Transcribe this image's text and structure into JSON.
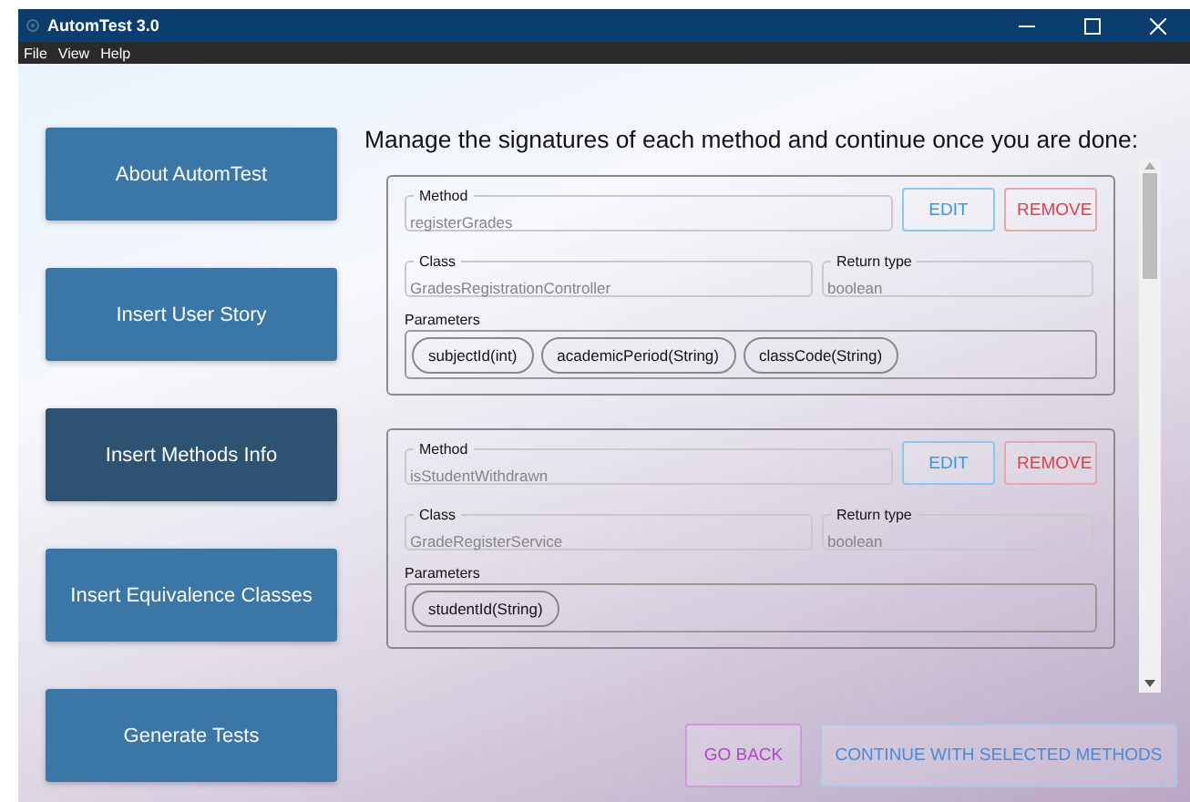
{
  "window": {
    "title": "AutomTest 3.0"
  },
  "menu": [
    "File",
    "View",
    "Help"
  ],
  "sidebar": {
    "items": [
      {
        "label": "About AutomTest",
        "selected": false
      },
      {
        "label": "Insert User Story",
        "selected": false
      },
      {
        "label": "Insert Methods Info",
        "selected": true
      },
      {
        "label": "Insert Equivalence Classes",
        "selected": false
      },
      {
        "label": "Generate Tests",
        "selected": false
      }
    ]
  },
  "heading": "Manage the signatures of each method and continue once you are done:",
  "methods": [
    {
      "method_label": "Method",
      "method": "registerGrades",
      "disabled": true,
      "edit": "EDIT",
      "remove": "REMOVE",
      "class_label": "Class",
      "class": "GradesRegistrationController",
      "return_label": "Return type",
      "return_type": "boolean",
      "parameters_label": "Parameters",
      "parameters": [
        "subjectId(int)",
        "academicPeriod(String)",
        "classCode(String)"
      ]
    },
    {
      "method_label": "Method",
      "method": "isStudentWithdrawn",
      "disabled": true,
      "edit": "EDIT",
      "remove": "REMOVE",
      "class_label": "Class",
      "class": "GradeRegisterService",
      "return_label": "Return type",
      "return_type": "boolean",
      "parameters_label": "Parameters",
      "parameters": [
        "studentId(String)"
      ]
    }
  ],
  "buttons": {
    "back": "GO BACK",
    "continue": "CONTINUE WITH SELECTED METHODS"
  }
}
